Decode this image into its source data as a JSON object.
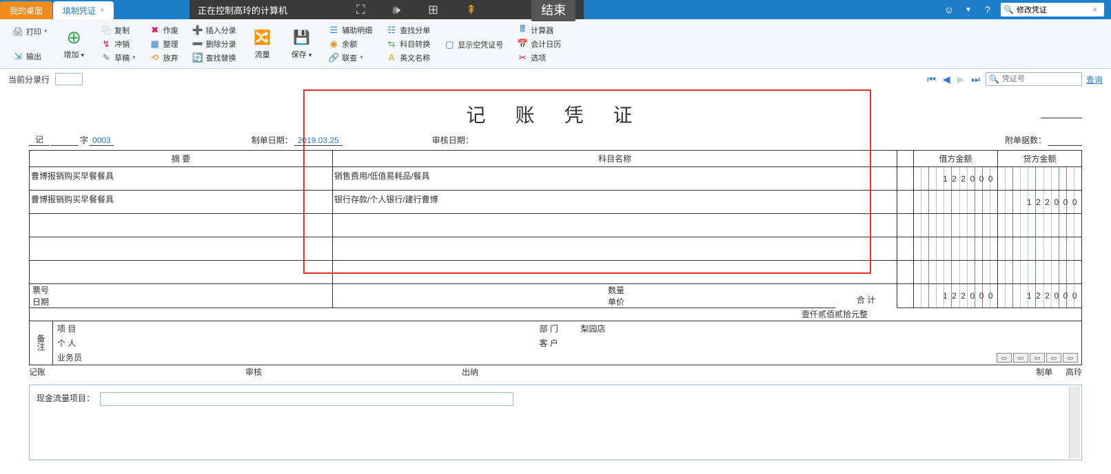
{
  "overlay": {
    "text": "正在控制高玲的计算机",
    "end": "结束"
  },
  "tabs": [
    {
      "label": "我的桌面"
    },
    {
      "label": "填制凭证"
    }
  ],
  "search_top": {
    "placeholder": "修改凭证"
  },
  "ribbon": {
    "print": "打印",
    "output": "输出",
    "add": "增加",
    "copy": "复制",
    "offset": "冲销",
    "draft": "草稿",
    "void": "作废",
    "tidy": "整理",
    "discard": "放弃",
    "insert_entry": "插入分录",
    "delete_entry": "删除分录",
    "find_replace": "查找替换",
    "flow": "流量",
    "save": "保存",
    "aux_detail": "辅助明细",
    "balance": "余额",
    "related": "联查",
    "find_split": "查找分单",
    "subj_switch": "科目转换",
    "eng_name": "英文名称",
    "show_empty": "显示空凭证号",
    "calculator": "计算器",
    "calendar": "会计日历",
    "options": "选项"
  },
  "subrow": {
    "cur_line": "当前分录行",
    "voucher_placeholder": "凭证号",
    "query": "查询"
  },
  "voucher": {
    "title": "记 账 凭 证",
    "prefix_ji": "记",
    "prefix_zi": "字",
    "number": "0003",
    "date_label": "制单日期：",
    "date": "2019.03.25",
    "audit_date_label": "审核日期：",
    "attach_label": "附单据数：",
    "cols": {
      "summary": "摘 要",
      "subject": "科目名称",
      "debit": "借方金额",
      "credit": "贷方金额"
    },
    "entries": [
      {
        "summary": "曹博报销购买早餐餐具",
        "subject": "销售费用/低值易耗品/餐具",
        "debit": "122000",
        "credit": ""
      },
      {
        "summary": "曹博报销购买早餐餐具",
        "subject": "银行存款/个人银行/建行曹博",
        "debit": "",
        "credit": "122000"
      },
      {
        "summary": "",
        "subject": "",
        "debit": "",
        "credit": ""
      },
      {
        "summary": "",
        "subject": "",
        "debit": "",
        "credit": ""
      },
      {
        "summary": "",
        "subject": "",
        "debit": "",
        "credit": ""
      }
    ],
    "total_label": "合 计",
    "total_debit": "122000",
    "total_credit": "122000",
    "total_words": "壹仟贰佰贰拾元整",
    "ticket": "票号",
    "date_row": "日期",
    "qty": "数量",
    "price": "单价",
    "remark": "备注",
    "project": "项 目",
    "dept": "部 门",
    "dept_val": "梨园店",
    "person": "个 人",
    "customer": "客 户",
    "salesman": "业务员",
    "sign_book": "记账",
    "sign_audit": "审核",
    "sign_cashier": "出纳",
    "sign_maker": "制单",
    "maker_name": "高玲"
  },
  "footer": {
    "label": "现金流量项目："
  }
}
